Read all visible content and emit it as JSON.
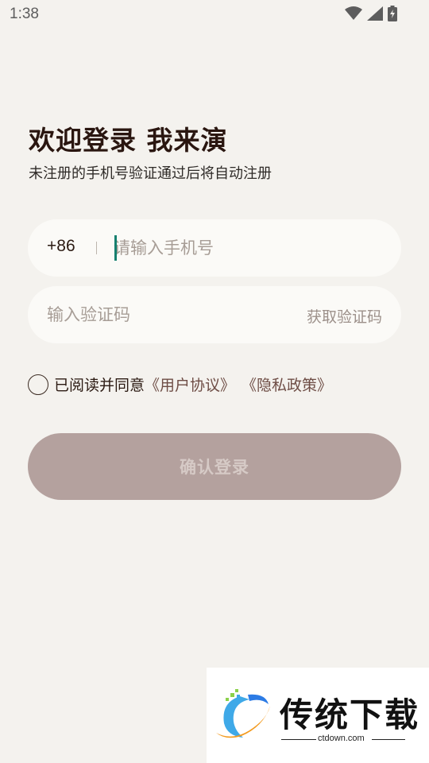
{
  "status_bar": {
    "time": "1:38",
    "icons": [
      "wifi-icon",
      "cell-signal-icon",
      "battery-charging-icon"
    ]
  },
  "header": {
    "title": "欢迎登录 我来演",
    "subtitle": "未注册的手机号验证通过后将自动注册"
  },
  "phone_field": {
    "country_code": "+86",
    "placeholder": "请输入手机号",
    "value": ""
  },
  "code_field": {
    "placeholder": "输入验证码",
    "value": "",
    "get_code_label": "获取验证码"
  },
  "agreement": {
    "checked": false,
    "text": "已阅读并同意",
    "user_agreement_link": "《用户协议》",
    "privacy_policy_link": "《隐私政策》"
  },
  "login_button": {
    "label": "确认登录"
  },
  "watermark": {
    "title": "传统下载",
    "url": "ctdown.com"
  },
  "colors": {
    "background": "#f4f2ee",
    "field_background": "#fbfaf7",
    "caret": "#16806f",
    "button_disabled": "#b4a19e",
    "link": "#6e4d45"
  }
}
